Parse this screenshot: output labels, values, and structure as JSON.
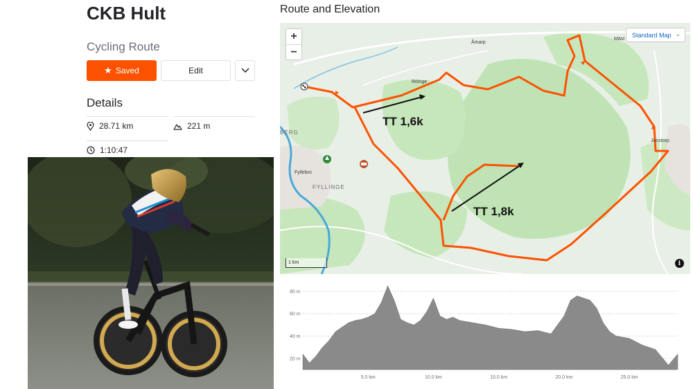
{
  "route": {
    "title": "CKB Hult",
    "type": "Cycling Route"
  },
  "actions": {
    "saved_label": "Saved",
    "edit_label": "Edit",
    "more_icon": "chevron-down-icon",
    "saved_icon": "star-icon"
  },
  "details": {
    "heading": "Details",
    "distance": "28.71 km",
    "elevation_gain": "221 m",
    "duration": "1:10:47",
    "distance_icon": "location-pin-icon",
    "elevation_icon": "mountain-icon",
    "duration_icon": "clock-icon"
  },
  "photo": {
    "description_icon": "cyclist-photo"
  },
  "map": {
    "heading": "Route and Elevation",
    "style_label": "Standard Map",
    "zoom_in": "+",
    "zoom_out": "−",
    "scale_label": "1 km",
    "info": "i",
    "places": {
      "amarp": "Åmarp",
      "roinge": "Röinge",
      "jonstorp": "Jonstorp",
      "fyllebro": "Fyllebro",
      "fyllinge": "FYLLINGE",
      "berg": "BERG",
      "mast": "Mäst"
    },
    "annotations": {
      "tt1": "TT 1,6k",
      "tt2": "TT 1,8k"
    },
    "colors": {
      "route": "#fc5200",
      "water": "#4aa8d8",
      "forest": "#bfe3b4",
      "land": "#e8efe6"
    }
  },
  "elevation": {
    "y_ticks": [
      "80 m",
      "60 m",
      "40 m",
      "20 m"
    ],
    "x_ticks": [
      "5.0 km",
      "10.0 km",
      "15.0 km",
      "20.0 km",
      "25.0 km"
    ]
  },
  "chart_data": {
    "type": "area",
    "title": "",
    "xlabel": "",
    "ylabel": "",
    "xlim": [
      0,
      28.71
    ],
    "ylim": [
      10,
      88
    ],
    "x": [
      0,
      0.5,
      1.0,
      1.5,
      2.0,
      2.5,
      3.0,
      3.5,
      4.0,
      4.5,
      5.0,
      5.5,
      6.0,
      6.5,
      7.0,
      7.5,
      8.0,
      8.5,
      9.0,
      9.5,
      10.0,
      10.5,
      11.0,
      11.5,
      12.0,
      13.0,
      14.0,
      15.0,
      16.0,
      17.0,
      18.0,
      19.0,
      20.0,
      20.5,
      21.0,
      21.5,
      22.0,
      22.5,
      23.0,
      23.5,
      24.0,
      25.0,
      26.0,
      27.0,
      28.0,
      28.71
    ],
    "values": [
      24,
      16,
      22,
      30,
      36,
      44,
      48,
      52,
      54,
      55,
      57,
      60,
      70,
      85,
      72,
      55,
      52,
      50,
      54,
      62,
      74,
      58,
      55,
      57,
      54,
      52,
      50,
      47,
      46,
      44,
      45,
      42,
      58,
      72,
      76,
      74,
      72,
      65,
      52,
      44,
      40,
      38,
      32,
      28,
      14,
      24
    ]
  }
}
